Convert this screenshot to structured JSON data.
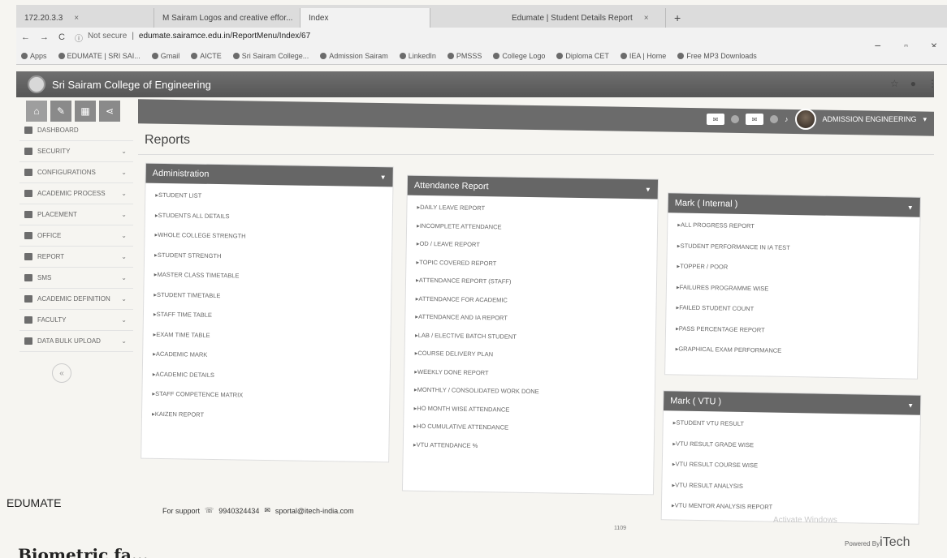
{
  "browser": {
    "tabs": [
      {
        "label": "172.20.3.3"
      },
      {
        "label": "M Sairam Logos and creative effor..."
      },
      {
        "label": "Index"
      },
      {
        "label": "Edumate | Student Details Report"
      }
    ],
    "new_tab": "+",
    "nav": {
      "back": "←",
      "forward": "→",
      "reload": "C"
    },
    "address": {
      "security": "Not secure",
      "url": "edumate.sairamce.edu.in/ReportMenu/Index/67"
    },
    "window_controls": {
      "minimize": "−",
      "maximize": "▫",
      "close": "×"
    },
    "bookmarks": [
      "Apps",
      "EDUMATE | SRI SAI...",
      "Gmail",
      "AICTE",
      "Sri Sairam College...",
      "Admission Sairam",
      "LinkedIn",
      "PMSSS",
      "College Logo",
      "Diploma CET",
      "IEA | Home",
      "Free MP3 Downloads"
    ]
  },
  "app": {
    "title": "Sri Sairam College of Engineering",
    "user": {
      "name": "ADMISSION ENGINEERING"
    },
    "header_icons": [
      "mail-icon",
      "bell-icon"
    ]
  },
  "sidebar": {
    "items": [
      {
        "label": "DASHBOARD"
      },
      {
        "label": "SECURITY"
      },
      {
        "label": "CONFIGURATIONS"
      },
      {
        "label": "ACADEMIC PROCESS"
      },
      {
        "label": "PLACEMENT"
      },
      {
        "label": "OFFICE"
      },
      {
        "label": "REPORT"
      },
      {
        "label": "SMS"
      },
      {
        "label": "ACADEMIC DEFINITION"
      },
      {
        "label": "FACULTY"
      },
      {
        "label": "DATA BULK UPLOAD"
      }
    ],
    "collapse": "«"
  },
  "page": {
    "title": "Reports"
  },
  "panels": {
    "admin": {
      "title": "Administration",
      "items": [
        "STUDENT LIST",
        "STUDENTS ALL DETAILS",
        "WHOLE COLLEGE STRENGTH",
        "STUDENT STRENGTH",
        "MASTER CLASS TIMETABLE",
        "STUDENT TIMETABLE",
        "STAFF TIME TABLE",
        "EXAM TIME TABLE",
        "ACADEMIC MARK",
        "ACADEMIC DETAILS",
        "STAFF COMPETENCE MATRIX",
        "KAIZEN REPORT"
      ]
    },
    "attendance": {
      "title": "Attendance Report",
      "items": [
        "DAILY LEAVE REPORT",
        "INCOMPLETE ATTENDANCE",
        "OD / LEAVE REPORT",
        "TOPIC COVERED REPORT",
        "ATTENDANCE REPORT (STAFF)",
        "ATTENDANCE FOR ACADEMIC",
        "ATTENDANCE AND IA REPORT",
        "LAB / ELECTIVE BATCH STUDENT",
        "COURSE DELIVERY PLAN",
        "WEEKLY DONE REPORT",
        "MONTHLY / CONSOLIDATED WORK DONE",
        "HO MONTH WISE ATTENDANCE",
        "HO CUMULATIVE ATTENDANCE",
        "VTU ATTENDANCE %"
      ]
    },
    "internal": {
      "title": "Mark ( Internal )",
      "items": [
        "ALL PROGRESS REPORT",
        "STUDENT PERFORMANCE IN IA TEST",
        "TOPPER / POOR",
        "FAILURES PROGRAMME WISE",
        "FAILED STUDENT COUNT",
        "PASS PERCENTAGE REPORT",
        "GRAPHICAL EXAM PERFORMANCE"
      ]
    },
    "vtu": {
      "title": "Mark ( VTU )",
      "items": [
        "STUDENT VTU RESULT",
        "VTU RESULT GRADE WISE",
        "VTU RESULT COURSE WISE",
        "VTU RESULT ANALYSIS",
        "VTU MENTOR ANALYSIS REPORT"
      ]
    }
  },
  "footer": {
    "brand": "EDUMATE",
    "support_label": "For support",
    "phone": "9940324434",
    "email": "sportal@itech-india.com",
    "count": "1109",
    "watermark": "Activate Windows",
    "powered_prefix": "Powered By",
    "powered_brand": "iTech"
  },
  "below_text": "Biometric fa..."
}
